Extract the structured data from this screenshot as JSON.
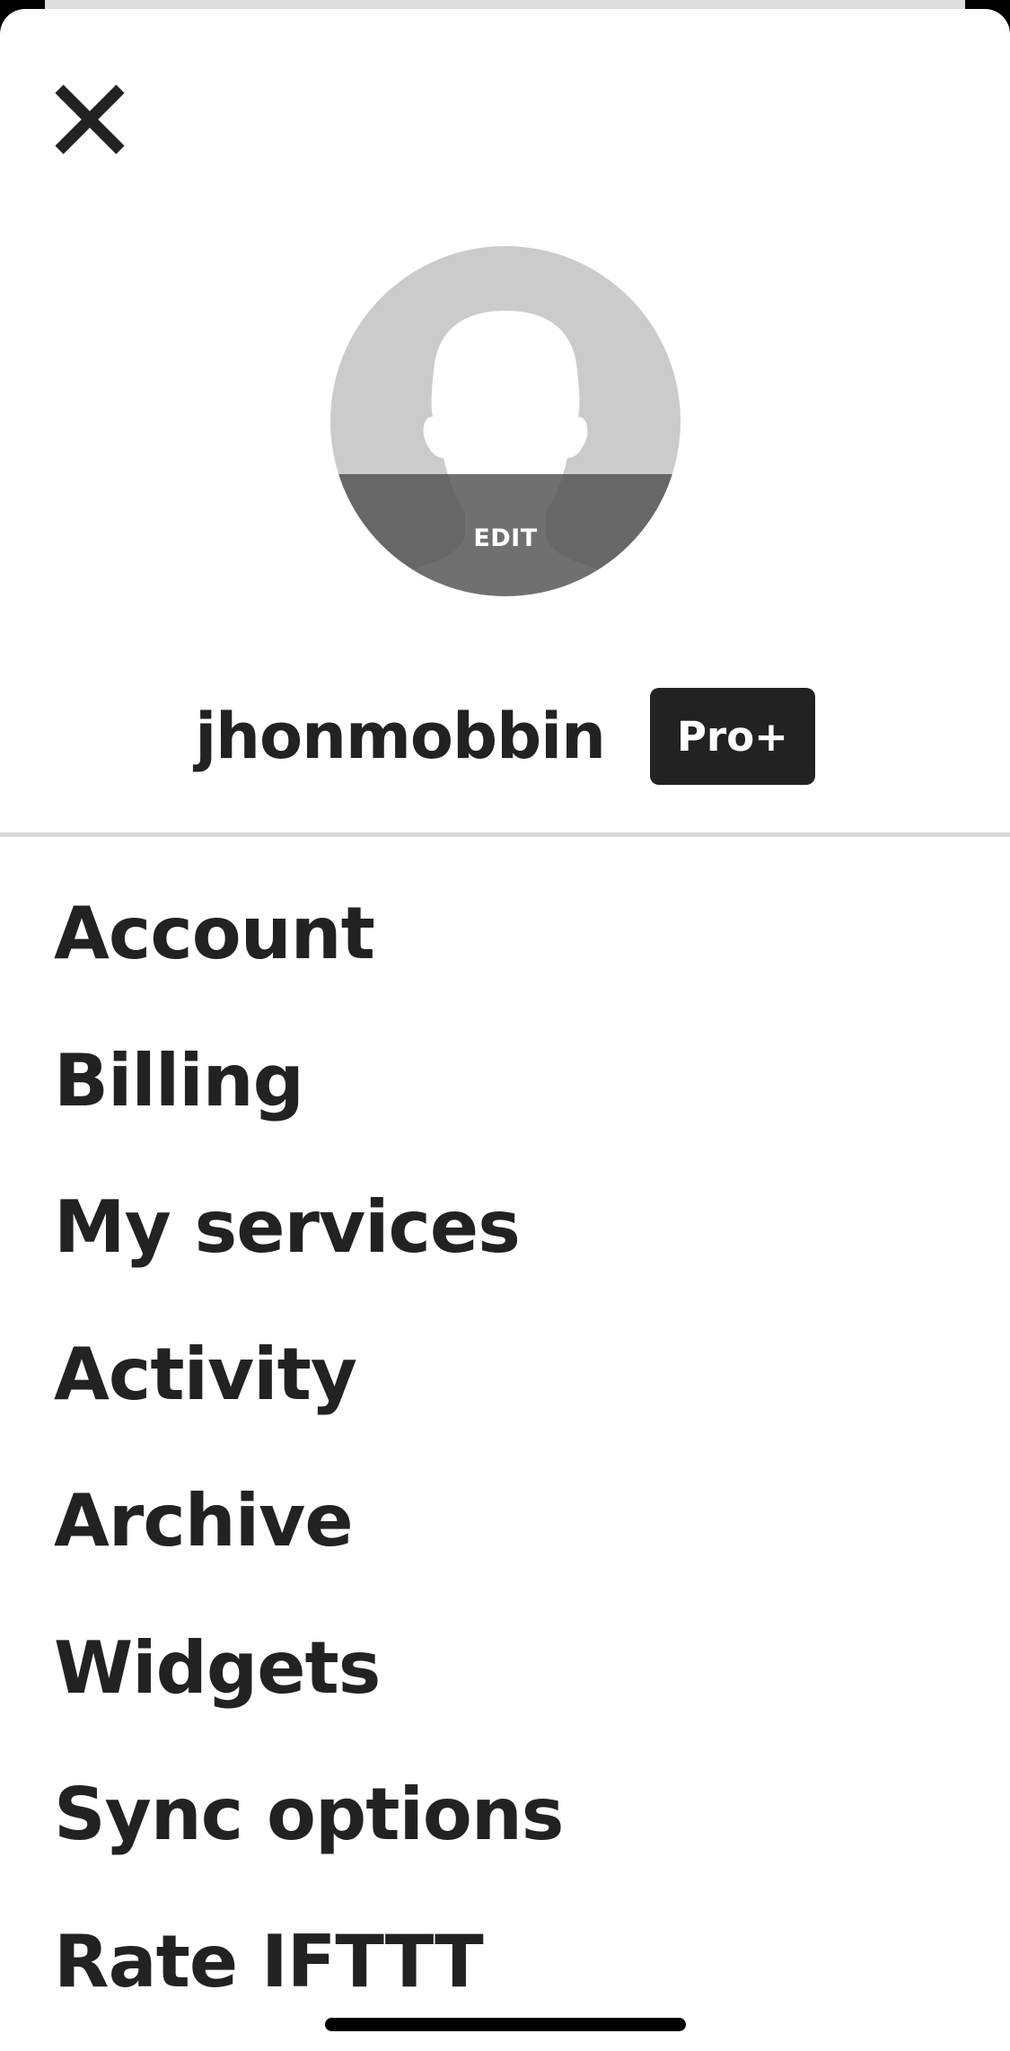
{
  "header": {
    "close_icon": "close-icon"
  },
  "profile": {
    "avatar_icon": "person-silhouette-icon",
    "edit_label": "EDIT",
    "username": "jhonmobbin",
    "plan_badge": "Pro+"
  },
  "menu": {
    "items": [
      {
        "label": "Account"
      },
      {
        "label": "Billing"
      },
      {
        "label": "My services"
      },
      {
        "label": "Activity"
      },
      {
        "label": "Archive"
      },
      {
        "label": "Widgets"
      },
      {
        "label": "Sync options"
      },
      {
        "label": "Rate IFTTT"
      }
    ]
  },
  "colors": {
    "text": "#222222",
    "badge_bg": "#222222",
    "badge_text": "#ffffff",
    "avatar_bg": "#cbcbcb",
    "divider": "#d9d9d9",
    "background": "#ffffff"
  }
}
